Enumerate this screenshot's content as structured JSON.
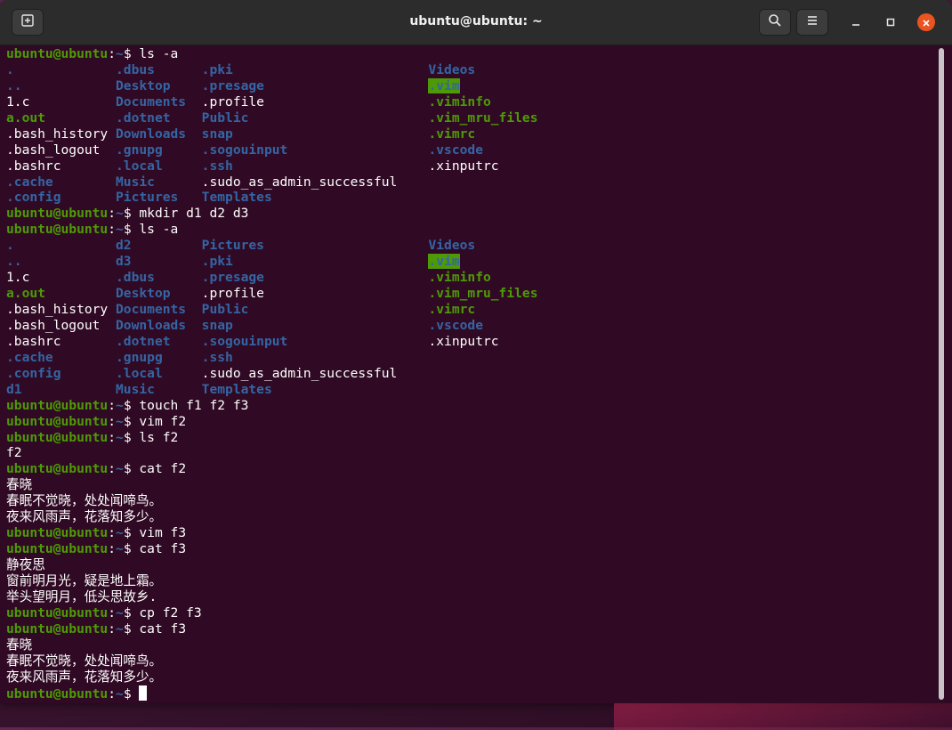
{
  "window": {
    "title": "ubuntu@ubuntu: ~"
  },
  "icons": {
    "new_tab": "new-tab-icon",
    "search": "search-icon",
    "menu": "hamburger-menu-icon",
    "minimize": "minimize-icon",
    "maximize": "maximize-icon",
    "close": "close-icon"
  },
  "colors": {
    "terminal_bg": "#300a24",
    "prompt_user": "#4e9a06",
    "prompt_path": "#3465a4",
    "directory": "#3465a4",
    "executable": "#4e9a06",
    "close_button": "#e95420"
  },
  "terminal": {
    "lines": [
      [
        {
          "t": "ubuntu@ubuntu",
          "c": "pu"
        },
        {
          "t": ":"
        },
        {
          "t": "~",
          "c": "pd"
        },
        {
          "t": "$ ls -a"
        }
      ],
      [
        {
          "t": ".             ",
          "c": "dir"
        },
        {
          "t": ".dbus      ",
          "c": "dir"
        },
        {
          "t": ".pki                         ",
          "c": "dir"
        },
        {
          "t": "Videos",
          "c": "dir"
        }
      ],
      [
        {
          "t": "..            ",
          "c": "dir"
        },
        {
          "t": "Desktop    ",
          "c": "dir"
        },
        {
          "t": ".presage                     ",
          "c": "dir"
        },
        {
          "t": ".vim",
          "c": "hl"
        }
      ],
      [
        {
          "t": "1.c           "
        },
        {
          "t": "Documents  ",
          "c": "dir"
        },
        {
          "t": ".profile                     "
        },
        {
          "t": ".viminfo",
          "c": "exe"
        }
      ],
      [
        {
          "t": "a.out         ",
          "c": "exe"
        },
        {
          "t": ".dotnet    ",
          "c": "dir"
        },
        {
          "t": "Public                       ",
          "c": "dir"
        },
        {
          "t": ".vim_mru_files",
          "c": "exe"
        }
      ],
      [
        {
          "t": ".bash_history "
        },
        {
          "t": "Downloads  ",
          "c": "dir"
        },
        {
          "t": "snap                         ",
          "c": "dir"
        },
        {
          "t": ".vimrc",
          "c": "exe"
        }
      ],
      [
        {
          "t": ".bash_logout  "
        },
        {
          "t": ".gnupg     ",
          "c": "dir"
        },
        {
          "t": ".sogouinput                  ",
          "c": "dir"
        },
        {
          "t": ".vscode",
          "c": "dir"
        }
      ],
      [
        {
          "t": ".bashrc       "
        },
        {
          "t": ".local     ",
          "c": "dir"
        },
        {
          "t": ".ssh                         ",
          "c": "dir"
        },
        {
          "t": ".xinputrc"
        }
      ],
      [
        {
          "t": ".cache        ",
          "c": "dir"
        },
        {
          "t": "Music      ",
          "c": "dir"
        },
        {
          "t": ".sudo_as_admin_successful"
        }
      ],
      [
        {
          "t": ".config       ",
          "c": "dir"
        },
        {
          "t": "Pictures   ",
          "c": "dir"
        },
        {
          "t": "Templates",
          "c": "dir"
        }
      ],
      [
        {
          "t": "ubuntu@ubuntu",
          "c": "pu"
        },
        {
          "t": ":"
        },
        {
          "t": "~",
          "c": "pd"
        },
        {
          "t": "$ mkdir d1 d2 d3"
        }
      ],
      [
        {
          "t": "ubuntu@ubuntu",
          "c": "pu"
        },
        {
          "t": ":"
        },
        {
          "t": "~",
          "c": "pd"
        },
        {
          "t": "$ ls -a"
        }
      ],
      [
        {
          "t": ".             ",
          "c": "dir"
        },
        {
          "t": "d2         ",
          "c": "dir"
        },
        {
          "t": "Pictures                     ",
          "c": "dir"
        },
        {
          "t": "Videos",
          "c": "dir"
        }
      ],
      [
        {
          "t": "..            ",
          "c": "dir"
        },
        {
          "t": "d3         ",
          "c": "dir"
        },
        {
          "t": ".pki                         ",
          "c": "dir"
        },
        {
          "t": ".vim",
          "c": "hl"
        }
      ],
      [
        {
          "t": "1.c           "
        },
        {
          "t": ".dbus      ",
          "c": "dir"
        },
        {
          "t": ".presage                     ",
          "c": "dir"
        },
        {
          "t": ".viminfo",
          "c": "exe"
        }
      ],
      [
        {
          "t": "a.out         ",
          "c": "exe"
        },
        {
          "t": "Desktop    ",
          "c": "dir"
        },
        {
          "t": ".profile                     "
        },
        {
          "t": ".vim_mru_files",
          "c": "exe"
        }
      ],
      [
        {
          "t": ".bash_history "
        },
        {
          "t": "Documents  ",
          "c": "dir"
        },
        {
          "t": "Public                       ",
          "c": "dir"
        },
        {
          "t": ".vimrc",
          "c": "exe"
        }
      ],
      [
        {
          "t": ".bash_logout  "
        },
        {
          "t": "Downloads  ",
          "c": "dir"
        },
        {
          "t": "snap                         ",
          "c": "dir"
        },
        {
          "t": ".vscode",
          "c": "dir"
        }
      ],
      [
        {
          "t": ".bashrc       "
        },
        {
          "t": ".dotnet    ",
          "c": "dir"
        },
        {
          "t": ".sogouinput                  ",
          "c": "dir"
        },
        {
          "t": ".xinputrc"
        }
      ],
      [
        {
          "t": ".cache        ",
          "c": "dir"
        },
        {
          "t": ".gnupg     ",
          "c": "dir"
        },
        {
          "t": ".ssh",
          "c": "dir"
        }
      ],
      [
        {
          "t": ".config       ",
          "c": "dir"
        },
        {
          "t": ".local     ",
          "c": "dir"
        },
        {
          "t": ".sudo_as_admin_successful"
        }
      ],
      [
        {
          "t": "d1            ",
          "c": "dir"
        },
        {
          "t": "Music      ",
          "c": "dir"
        },
        {
          "t": "Templates",
          "c": "dir"
        }
      ],
      [
        {
          "t": "ubuntu@ubuntu",
          "c": "pu"
        },
        {
          "t": ":"
        },
        {
          "t": "~",
          "c": "pd"
        },
        {
          "t": "$ touch f1 f2 f3"
        }
      ],
      [
        {
          "t": "ubuntu@ubuntu",
          "c": "pu"
        },
        {
          "t": ":"
        },
        {
          "t": "~",
          "c": "pd"
        },
        {
          "t": "$ vim f2"
        }
      ],
      [
        {
          "t": "ubuntu@ubuntu",
          "c": "pu"
        },
        {
          "t": ":"
        },
        {
          "t": "~",
          "c": "pd"
        },
        {
          "t": "$ ls f2"
        }
      ],
      [
        {
          "t": "f2"
        }
      ],
      [
        {
          "t": "ubuntu@ubuntu",
          "c": "pu"
        },
        {
          "t": ":"
        },
        {
          "t": "~",
          "c": "pd"
        },
        {
          "t": "$ cat f2"
        }
      ],
      [
        {
          "t": "春晓"
        }
      ],
      [
        {
          "t": "春眠不觉晓，处处闻啼鸟。"
        }
      ],
      [
        {
          "t": "夜来风雨声，花落知多少。"
        }
      ],
      [
        {
          "t": "ubuntu@ubuntu",
          "c": "pu"
        },
        {
          "t": ":"
        },
        {
          "t": "~",
          "c": "pd"
        },
        {
          "t": "$ vim f3"
        }
      ],
      [
        {
          "t": "ubuntu@ubuntu",
          "c": "pu"
        },
        {
          "t": ":"
        },
        {
          "t": "~",
          "c": "pd"
        },
        {
          "t": "$ cat f3"
        }
      ],
      [
        {
          "t": "静夜思"
        }
      ],
      [
        {
          "t": "窗前明月光，疑是地上霜。"
        }
      ],
      [
        {
          "t": "举头望明月，低头思故乡."
        }
      ],
      [
        {
          "t": "ubuntu@ubuntu",
          "c": "pu"
        },
        {
          "t": ":"
        },
        {
          "t": "~",
          "c": "pd"
        },
        {
          "t": "$ cp f2 f3"
        }
      ],
      [
        {
          "t": "ubuntu@ubuntu",
          "c": "pu"
        },
        {
          "t": ":"
        },
        {
          "t": "~",
          "c": "pd"
        },
        {
          "t": "$ cat f3"
        }
      ],
      [
        {
          "t": "春晓"
        }
      ],
      [
        {
          "t": "春眠不觉晓，处处闻啼鸟。"
        }
      ],
      [
        {
          "t": "夜来风雨声，花落知多少。"
        }
      ],
      [
        {
          "t": "ubuntu@ubuntu",
          "c": "pu"
        },
        {
          "t": ":"
        },
        {
          "t": "~",
          "c": "pd"
        },
        {
          "t": "$ "
        },
        {
          "cursor": true
        }
      ]
    ]
  }
}
